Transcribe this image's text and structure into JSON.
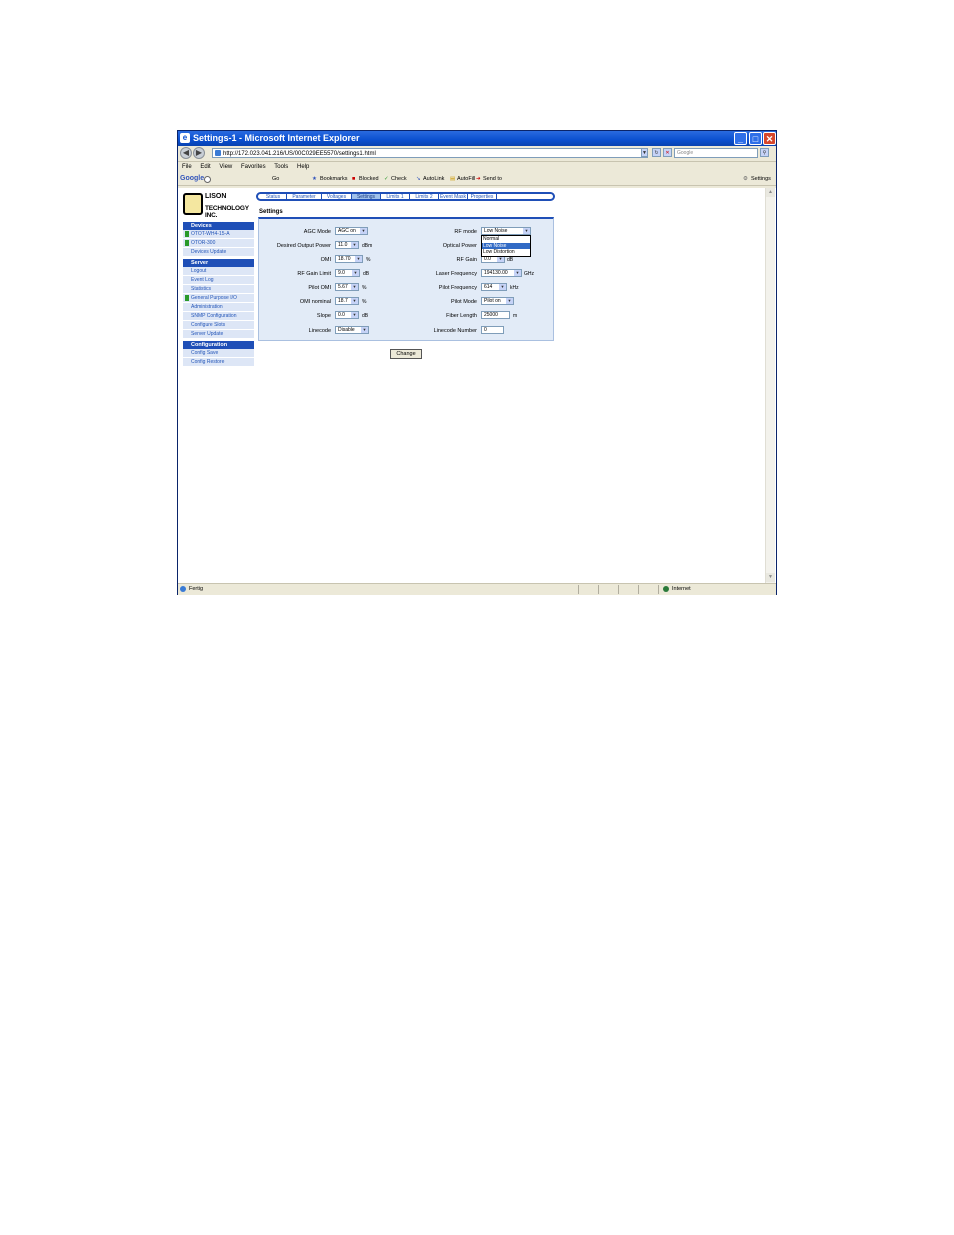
{
  "window": {
    "title": "Settings-1 - Microsoft Internet Explorer"
  },
  "address_bar": {
    "url": "http://172.023.041.216/US/00C029EE5570/settings1.html",
    "search_placeholder": "Google"
  },
  "menu": [
    "File",
    "Edit",
    "View",
    "Favorites",
    "Tools",
    "Help"
  ],
  "google_toolbar": {
    "brand": "Google",
    "go": "Go",
    "bookmarks": "Bookmarks",
    "blocked": "Blocked",
    "check": "Check",
    "autolink": "AutoLink",
    "autofill": "AutoFill",
    "sendto": "Send to",
    "settings": "Settings"
  },
  "logo": {
    "line1": "LISON",
    "line2": "TECHNOLOGY INC."
  },
  "sidebar": {
    "devices_header": "Devices",
    "devices": [
      {
        "label": "OTOT-WH4-15-A",
        "flag": true
      },
      {
        "label": "OTOR-300",
        "flag": true
      },
      {
        "label": "Devices Update",
        "flag": false
      }
    ],
    "server_header": "Server",
    "server": [
      {
        "label": "Logout",
        "flag": false
      },
      {
        "label": "Event Log",
        "flag": false
      },
      {
        "label": "Statistics",
        "flag": false
      },
      {
        "label": "General Purpose I/O",
        "flag": true
      },
      {
        "label": "Administration",
        "flag": false
      },
      {
        "label": "SNMP Configuration",
        "flag": false
      },
      {
        "label": "Configure Slots",
        "flag": false
      },
      {
        "label": "Server Update",
        "flag": false
      }
    ],
    "config_header": "Configuration",
    "config": [
      {
        "label": "Config Save",
        "flag": false
      },
      {
        "label": "Config Restore",
        "flag": false
      }
    ]
  },
  "tabs": [
    "Status",
    "Parameter",
    "Voltages",
    "Settings",
    "Limits 1",
    "Limits 2",
    "Event Mask",
    "Properties"
  ],
  "active_tab": "Settings",
  "section_title": "Settings",
  "settings_left": [
    {
      "label": "AGC Mode",
      "value": "AGC on",
      "unit": ""
    },
    {
      "label": "Desired Output Power",
      "value": "11.0",
      "unit": "dBm"
    },
    {
      "label": "OMI",
      "value": "18.70",
      "unit": "%"
    },
    {
      "label": "RF Gain Limit",
      "value": "9.0",
      "unit": "dB"
    },
    {
      "label": "Pilot OMI",
      "value": "5.67",
      "unit": "%"
    },
    {
      "label": "OMI nominal",
      "value": "18.7",
      "unit": "%"
    },
    {
      "label": "Slope",
      "value": "0.0",
      "unit": "dB"
    },
    {
      "label": "Linecode",
      "value": "Disable",
      "unit": ""
    }
  ],
  "settings_right": [
    {
      "label": "RF mode",
      "value": "Low Noise",
      "unit": "",
      "type": "select"
    },
    {
      "label": "Optical Power",
      "value": "",
      "unit": "",
      "type": "hidden"
    },
    {
      "label": "RF Gain",
      "value": "0.0",
      "unit": "dB",
      "type": "select"
    },
    {
      "label": "Laser Frequency",
      "value": "194130.00",
      "unit": "GHz",
      "type": "select"
    },
    {
      "label": "Pilot Frequency",
      "value": "614",
      "unit": "kHz",
      "type": "select"
    },
    {
      "label": "Pilot Mode",
      "value": "Pilot on",
      "unit": "",
      "type": "select"
    },
    {
      "label": "Fiber Length",
      "value": "25000",
      "unit": "m",
      "type": "input"
    },
    {
      "label": "Linecode Number",
      "value": "0",
      "unit": "",
      "type": "input"
    }
  ],
  "rf_mode_dropdown": [
    "Normal",
    "Low Noise",
    "Low Distortion"
  ],
  "rf_mode_highlighted": "Low Noise",
  "change_button": "Change",
  "status_bar": {
    "left": "Fertig",
    "zone": "Internet"
  }
}
